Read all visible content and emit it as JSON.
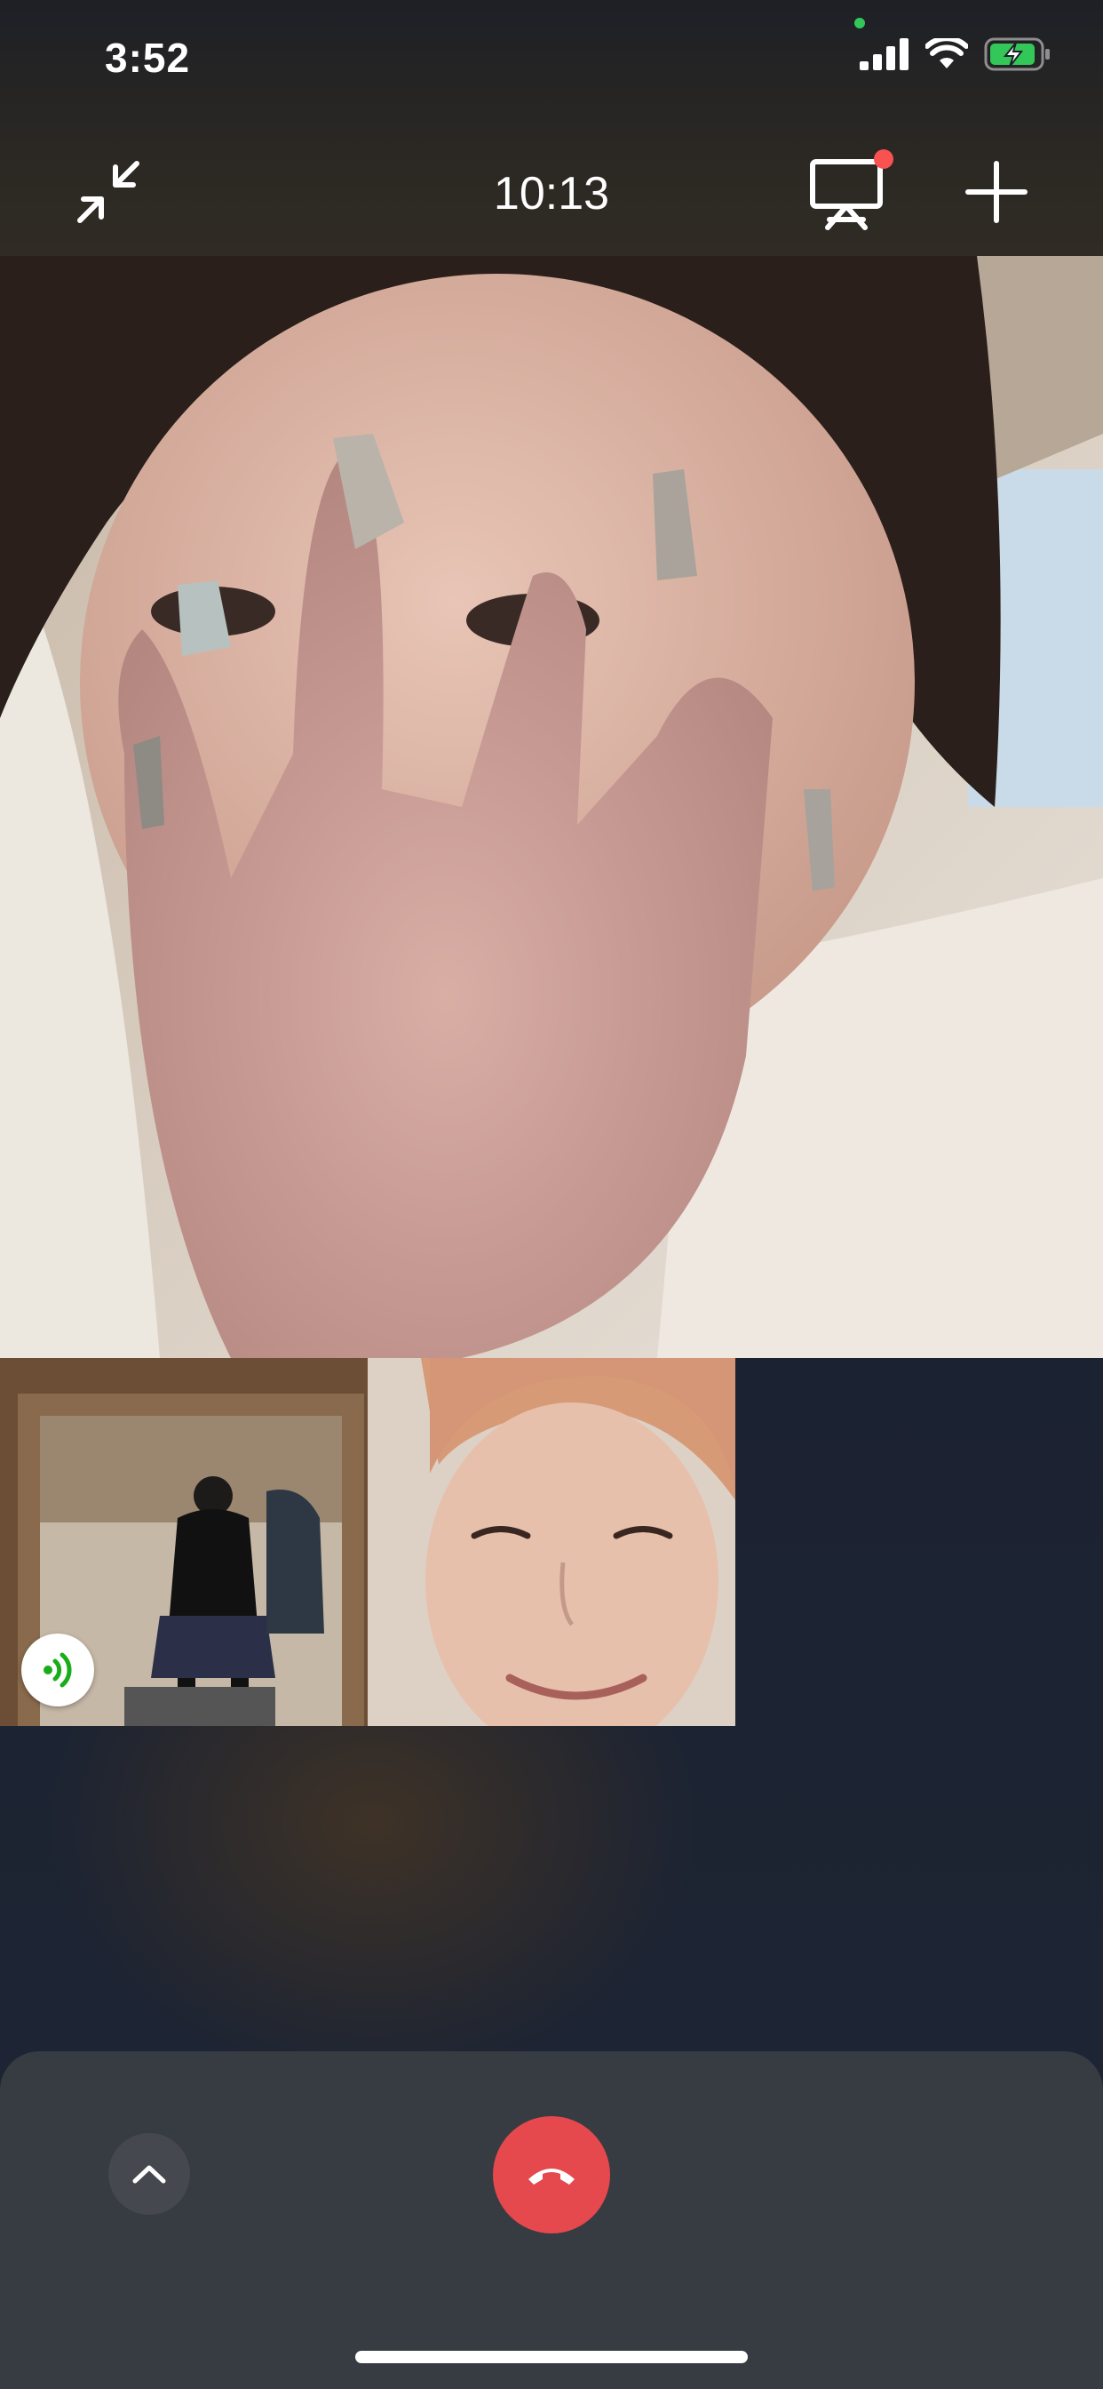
{
  "status_bar": {
    "time": "3:52",
    "signal_icon": "cellular-signal-icon",
    "wifi_icon": "wifi-icon",
    "battery_icon": "battery-charging-icon",
    "battery_color": "#33c759"
  },
  "call_header": {
    "duration": "10:13",
    "collapse_icon": "collapse-arrows-icon",
    "screen_share_icon": "screen-share-icon",
    "add_icon": "add-participant-icon",
    "notification_dot_color": "#fa5151"
  },
  "participants": {
    "main": {
      "type": "video",
      "description_icon": "main-video-feed"
    },
    "tiles": [
      {
        "icon": "participant-video-1",
        "speaking": true,
        "speaking_icon": "speaking-wave-icon",
        "speaking_color": "#1aad19"
      },
      {
        "icon": "participant-video-2",
        "speaking": false
      }
    ]
  },
  "controls": {
    "expand_icon": "chevron-up-icon",
    "hangup_icon": "hang-up-phone-icon",
    "hangup_color": "#e5484d"
  }
}
